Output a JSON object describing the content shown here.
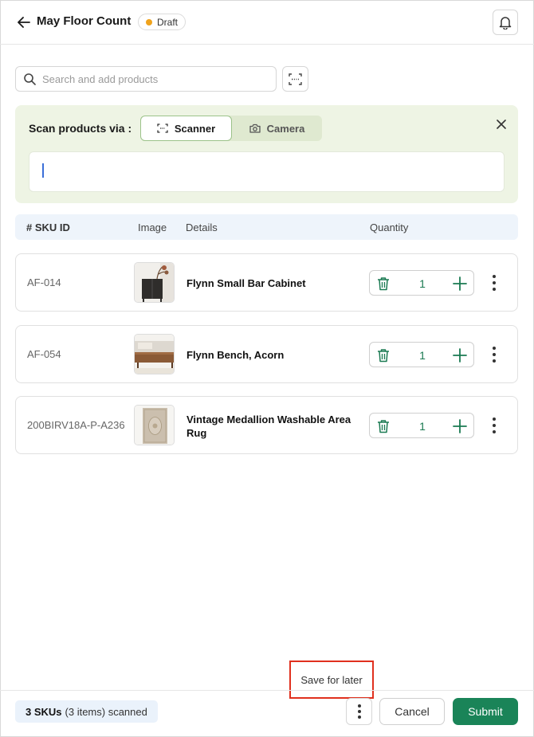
{
  "header": {
    "title": "May Floor Count",
    "status_badge": "Draft",
    "status_color": "#f0a31c"
  },
  "search": {
    "placeholder": "Search and add products"
  },
  "scan_panel": {
    "label": "Scan products via :",
    "modes": [
      "Scanner",
      "Camera"
    ],
    "selected_mode": "Scanner",
    "input_value": ""
  },
  "table": {
    "columns": [
      "# SKU ID",
      "Image",
      "Details",
      "Quantity"
    ],
    "rows": [
      {
        "sku": "AF-014",
        "name": "Flynn Small Bar Cabinet",
        "quantity": "1"
      },
      {
        "sku": "AF-054",
        "name": "Flynn Bench, Acorn",
        "quantity": "1"
      },
      {
        "sku": "200BIRV18A-P-A236",
        "name": "Vintage Medallion Washable Area Rug",
        "quantity": "1"
      }
    ]
  },
  "footer": {
    "sku_count": "3 SKUs",
    "items_scanned": "(3 items) scanned",
    "save_for_later": "Save for later",
    "cancel_label": "Cancel",
    "submit_label": "Submit",
    "accent_color": "#1a8458"
  }
}
